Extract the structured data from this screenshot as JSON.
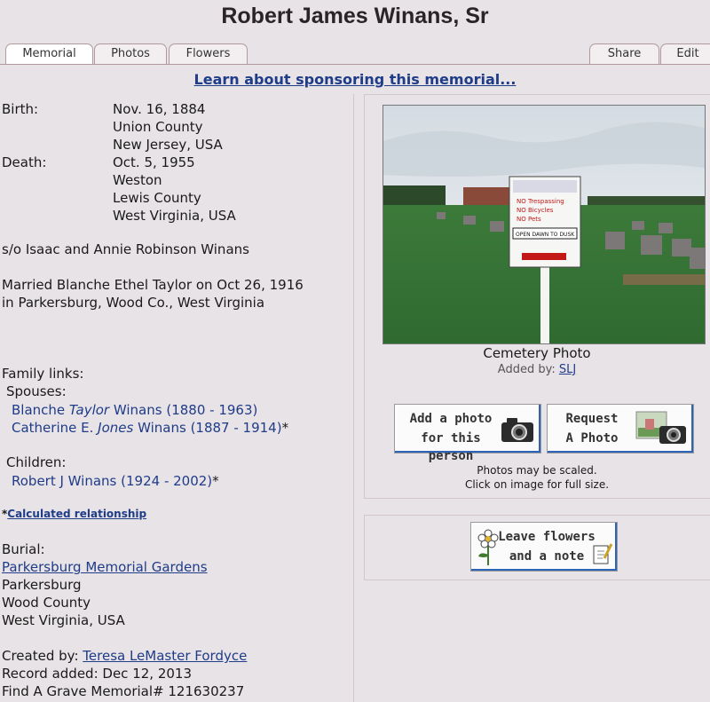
{
  "title": "Robert James Winans, Sr",
  "tabs": [
    "Memorial",
    "Photos",
    "Flowers"
  ],
  "tabs_right": [
    "Share",
    "Edit"
  ],
  "sponsor_link": "Learn about sponsoring this memorial...",
  "birth": {
    "label": "Birth:",
    "lines": [
      "Nov. 16, 1884",
      "Union County",
      "New Jersey, USA"
    ]
  },
  "death": {
    "label": "Death:",
    "lines": [
      "Oct. 5, 1955",
      "Weston",
      "Lewis County",
      "West Virginia, USA"
    ]
  },
  "bio": {
    "parents": "s/o Isaac and Annie Robinson Winans",
    "marriage_line1": "Married Blanche Ethel Taylor on Oct 26, 1916",
    "marriage_line2": "in Parkersburg, Wood Co., West Virginia"
  },
  "family": {
    "heading": "Family links:",
    "spouses_label": "Spouses:",
    "spouses": [
      {
        "first": "Blanche",
        "maiden": "Taylor",
        "last": "Winans",
        "years": "(1880 - 1963)",
        "suffix": ""
      },
      {
        "first": "Catherine E.",
        "maiden": "Jones",
        "last": "Winans",
        "years": "(1887 - 1914)",
        "suffix": "*"
      }
    ],
    "children_label": "Children:",
    "children": [
      {
        "name": "Robert J Winans",
        "years": "(1924 - 2002)",
        "suffix": "*"
      }
    ],
    "calc_asterisk": "*",
    "calc_link": "Calculated relationship"
  },
  "burial": {
    "label": "Burial:",
    "cemetery": "Parkersburg Memorial Gardens",
    "lines": [
      "Parkersburg",
      "Wood County",
      "West Virginia, USA"
    ]
  },
  "record": {
    "created_by_label": "Created by:",
    "created_by": "Teresa LeMaster Fordyce",
    "added": "Record added: Dec 12, 2013",
    "memorial_id": "Find A Grave Memorial# 121630237"
  },
  "photo": {
    "caption": "Cemetery Photo",
    "added_by_label": "Added by:",
    "added_by": "SLJ",
    "sign_lines": [
      "NO Trespassing",
      "NO Bicycles",
      "NO Pets",
      "OPEN DAWN TO DUSK"
    ]
  },
  "buttons": {
    "add_photo_1": "Add a photo",
    "add_photo_2": "for this person",
    "request_1": "Request",
    "request_2": "A Photo",
    "flowers_1": "Leave flowers",
    "flowers_2": "and a note"
  },
  "photo_note": {
    "line1": "Photos may be scaled.",
    "line2": "Click on image for full size."
  }
}
